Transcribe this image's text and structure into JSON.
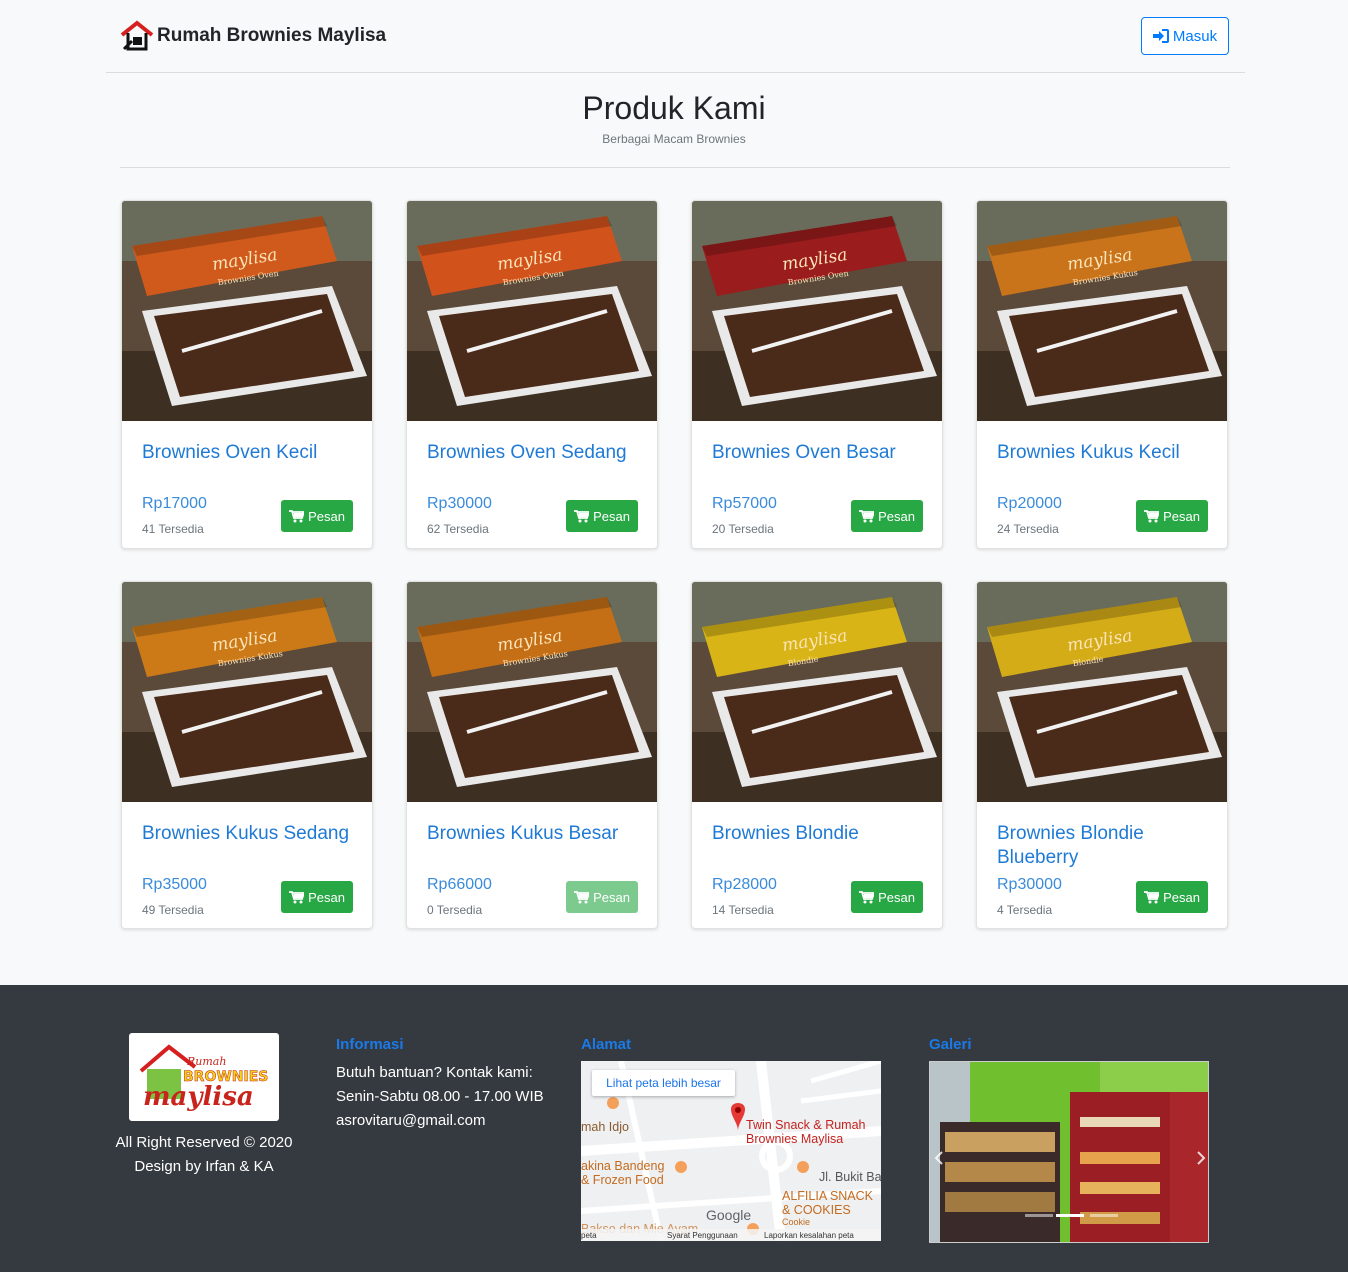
{
  "navbar": {
    "brand": "Rumah Brownies Maylisa",
    "login_label": "Masuk"
  },
  "section": {
    "title": "Produk Kami",
    "subtitle": "Berbagai Macam Brownies"
  },
  "products": [
    {
      "name": "Brownies Oven Kecil",
      "price": "Rp17000",
      "stock": "41 Tersedia",
      "button": "Pesan",
      "box": "#d05a1c",
      "box_label": "maylisa",
      "box_sub": "Brownies Oven"
    },
    {
      "name": "Brownies Oven Sedang",
      "price": "Rp30000",
      "stock": "62 Tersedia",
      "button": "Pesan",
      "box": "#d2521c",
      "box_label": "maylisa",
      "box_sub": "Brownies Oven"
    },
    {
      "name": "Brownies Oven Besar",
      "price": "Rp57000",
      "stock": "20 Tersedia",
      "button": "Pesan",
      "box": "#9a1c1c",
      "box_label": "maylisa",
      "box_sub": "Brownies Oven"
    },
    {
      "name": "Brownies Kukus Kecil",
      "price": "Rp20000",
      "stock": "24 Tersedia",
      "button": "Pesan",
      "box": "#c9731a",
      "box_label": "maylisa",
      "box_sub": "Brownies Kukus"
    },
    {
      "name": "Brownies Kukus Sedang",
      "price": "Rp35000",
      "stock": "49 Tersedia",
      "button": "Pesan",
      "box": "#cc7a18",
      "box_label": "maylisa",
      "box_sub": "Brownies Kukus"
    },
    {
      "name": "Brownies Kukus Besar",
      "price": "Rp66000",
      "stock": "0 Tersedia",
      "button": "Pesan",
      "box": "#c46e16",
      "box_label": "maylisa",
      "box_sub": "Brownies Kukus"
    },
    {
      "name": "Brownies Blondie",
      "price": "Rp28000",
      "stock": "14 Tersedia",
      "button": "Pesan",
      "box": "#d8b416",
      "box_label": "maylisa",
      "box_sub": "Blondie"
    },
    {
      "name": "Brownies Blondie Blueberry",
      "price": "Rp30000",
      "stock": "4 Tersedia",
      "button": "Pesan",
      "box": "#d4ac18",
      "box_label": "maylisa",
      "box_sub": "Blondie"
    }
  ],
  "footer": {
    "logo_top": "Rumah",
    "logo_mid": "BROWNIES",
    "logo_bottom": "maylisa",
    "copyright": "All Right Reserved © 2020",
    "design": "Design by Irfan & KA",
    "info_heading": "Informasi",
    "info_line1": "Butuh bantuan? Kontak kami:",
    "info_line2": "Senin-Sabtu 08.00 - 17.00 WIB",
    "info_line3": "asrovitaru@gmail.com",
    "address_heading": "Alamat",
    "gallery_heading": "Galeri",
    "map": {
      "link": "Lihat peta lebih besar",
      "pin_label_1": "Twin Snack & Rumah",
      "pin_label_2": "Brownies Maylisa",
      "place_1": "mah Idjo",
      "place_2a": "akina Bandeng",
      "place_2b": "& Frozen Food",
      "street": "Jl. Bukit Ba",
      "place_3a": "ALFILIA SNACK",
      "place_3b": "& COOKIES",
      "place_3c": "Cookie",
      "place_4": "Bakso dan Mie Ayam",
      "google": "Google",
      "terms": "Syarat Penggunaan",
      "report": "Laporkan kesalahan peta",
      "data": "peta"
    }
  }
}
